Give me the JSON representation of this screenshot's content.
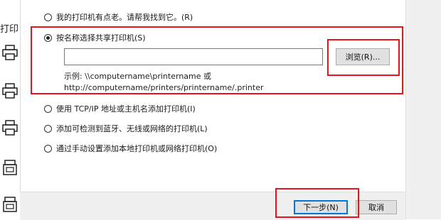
{
  "background": {
    "title": "打印"
  },
  "dialog": {
    "options": [
      {
        "label": "我的打印机有点老。请帮我找到它。(R)",
        "checked": false
      },
      {
        "label": "按名称选择共享打印机(S)",
        "checked": true
      },
      {
        "label": "使用 TCP/IP 地址或主机名添加打印机(I)",
        "checked": false
      },
      {
        "label": "添加可检测到蓝牙、无线或网络的打印机(L)",
        "checked": false
      },
      {
        "label": "通过手动设置添加本地打印机或网络打印机(O)",
        "checked": false
      }
    ],
    "shared_printer": {
      "value": "",
      "browse_label": "浏览(R)...",
      "example_line1": "示例: \\\\computername\\printername 或",
      "example_line2": "http://computername/printers/printername/.printer"
    },
    "footer": {
      "next_label": "下一步(N)",
      "cancel_label": "取消"
    }
  },
  "colors": {
    "highlight": "#e8141b",
    "accent": "#0078d7"
  }
}
